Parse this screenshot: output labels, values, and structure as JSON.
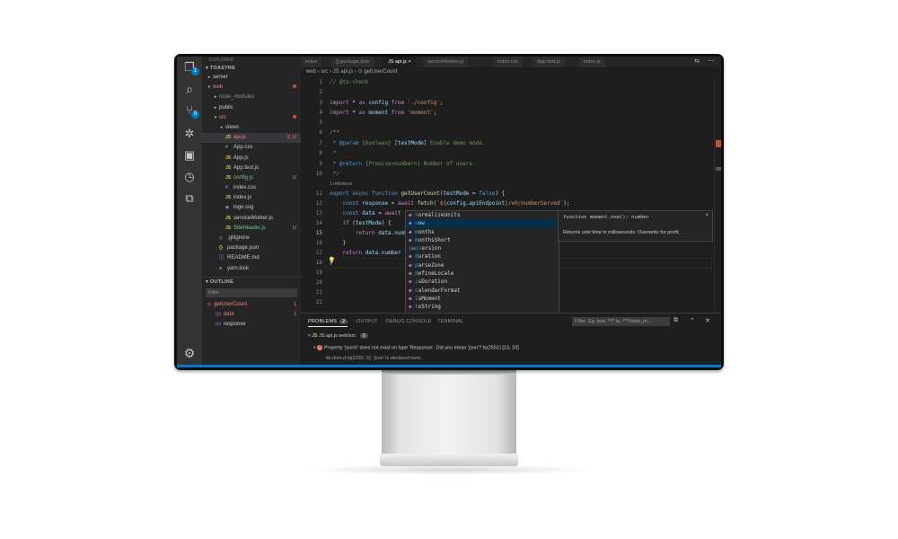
{
  "activity_bar": {
    "explorer_badge": "1",
    "scm_badge": "5"
  },
  "sidebar": {
    "header": "EXPLORER",
    "project": "TOASTRE",
    "tree": [
      {
        "label": "server",
        "twisty": "▸",
        "depth": 0,
        "color": "#cccccc",
        "icon": "",
        "status": ""
      },
      {
        "label": "web",
        "twisty": "▾",
        "depth": 0,
        "color": "#f48771",
        "icon": "",
        "status": "dot"
      },
      {
        "label": "node_modules",
        "twisty": "▸",
        "depth": 1,
        "color": "#8c8c8c",
        "icon": "",
        "status": ""
      },
      {
        "label": "public",
        "twisty": "▸",
        "depth": 1,
        "color": "#cccccc",
        "icon": "",
        "status": ""
      },
      {
        "label": "src",
        "twisty": "▾",
        "depth": 1,
        "color": "#f48771",
        "icon": "",
        "status": "dot"
      },
      {
        "label": "views",
        "twisty": "▸",
        "depth": 2,
        "color": "#cccccc",
        "icon": "",
        "status": ""
      },
      {
        "label": "api.js",
        "twisty": "",
        "depth": 2,
        "color": "#f48771",
        "icon": "JS",
        "status": "2, U"
      },
      {
        "label": "App.css",
        "twisty": "",
        "depth": 2,
        "color": "#cccccc",
        "icon": "#",
        "status": ""
      },
      {
        "label": "App.js",
        "twisty": "",
        "depth": 2,
        "color": "#cccccc",
        "icon": "JS",
        "status": ""
      },
      {
        "label": "App.test.js",
        "twisty": "",
        "depth": 2,
        "color": "#cccccc",
        "icon": "JS",
        "status": ""
      },
      {
        "label": "config.js",
        "twisty": "",
        "depth": 2,
        "color": "#73c991",
        "icon": "JS",
        "status": "U"
      },
      {
        "label": "index.css",
        "twisty": "",
        "depth": 2,
        "color": "#cccccc",
        "icon": "#",
        "status": ""
      },
      {
        "label": "index.js",
        "twisty": "",
        "depth": 2,
        "color": "#cccccc",
        "icon": "JS",
        "status": ""
      },
      {
        "label": "logo.svg",
        "twisty": "",
        "depth": 2,
        "color": "#cccccc",
        "icon": "◆",
        "status": ""
      },
      {
        "label": "serviceWorker.js",
        "twisty": "",
        "depth": 2,
        "color": "#cccccc",
        "icon": "JS",
        "status": ""
      },
      {
        "label": "SiteHeader.js",
        "twisty": "",
        "depth": 2,
        "color": "#73c991",
        "icon": "JS",
        "status": "U"
      },
      {
        "label": ".gitignore",
        "twisty": "",
        "depth": 1,
        "color": "#cccccc",
        "icon": "◇",
        "status": ""
      },
      {
        "label": "package.json",
        "twisty": "",
        "depth": 1,
        "color": "#cccccc",
        "icon": "{}",
        "status": ""
      },
      {
        "label": "README.md",
        "twisty": "",
        "depth": 1,
        "color": "#cccccc",
        "icon": "ⓘ",
        "status": ""
      },
      {
        "label": "yarn.lock",
        "twisty": "",
        "depth": 1,
        "color": "#cccccc",
        "icon": "♣",
        "status": ""
      }
    ],
    "outline_title": "OUTLINE",
    "outline_filter": "Filter",
    "outline": [
      {
        "label": "getUserCount",
        "icon": "⊙",
        "status": "1",
        "depth": 0,
        "color": "#f48771"
      },
      {
        "label": "data",
        "icon": "(x)",
        "status": "1",
        "depth": 1,
        "color": "#f48771"
      },
      {
        "label": "response",
        "icon": "(x)",
        "status": "",
        "depth": 1,
        "color": "#cccccc"
      }
    ]
  },
  "tabs": [
    {
      "label": "index",
      "active": false
    },
    {
      "label": "{} package.json",
      "active": false
    },
    {
      "label": "JS api.js ×",
      "active": true
    },
    {
      "label": "serviceWorker.js",
      "active": false
    },
    {
      "label": "index.css",
      "active": false
    },
    {
      "label": "App.test.js",
      "active": false
    },
    {
      "label": "index.js",
      "active": false
    }
  ],
  "breadcrumb": "web  ›  src  ›  JS api.js  ›  ⊙ getUserCount",
  "editor": {
    "line_numbers": [
      "1",
      "2",
      "3",
      "4",
      "5",
      "6",
      "7",
      "8",
      "9",
      "10",
      "",
      "11",
      "12",
      "13",
      "14",
      "15",
      "16",
      "17",
      "18",
      "19",
      "20",
      "21",
      "22"
    ],
    "references_lens": "1 reference"
  },
  "suggest": {
    "items": [
      {
        "label": "normalizeUnits",
        "match": "n",
        "icon": "◆"
      },
      {
        "label": "now",
        "match": "n",
        "icon": "◆"
      },
      {
        "label": "months",
        "match": "n",
        "icon": "◆"
      },
      {
        "label": "monthsShort",
        "match": "n",
        "icon": "◆"
      },
      {
        "label": "version",
        "match": "n",
        "icon": "[ab]"
      },
      {
        "label": "duration",
        "match": "n",
        "icon": "◆"
      },
      {
        "label": "parseZone",
        "match": "n",
        "icon": "◆"
      },
      {
        "label": "defineLocale",
        "match": "n",
        "icon": "◆"
      },
      {
        "label": "isDuration",
        "match": "n",
        "icon": "◆"
      },
      {
        "label": "calendarFormat",
        "match": "n",
        "icon": "◆"
      },
      {
        "label": "isMoment",
        "match": "n",
        "icon": "◆"
      },
      {
        "label": "toString",
        "match": "n",
        "icon": "◆"
      }
    ],
    "selected_index": 1,
    "detail_signature": "function moment.now(): number",
    "detail_description": "Returns unix time in milliseconds. Overwrite for profit.",
    "detail_close": "×"
  },
  "panel": {
    "tabs": [
      "PROBLEMS",
      "OUTPUT",
      "DEBUG CONSOLE",
      "TERMINAL"
    ],
    "problem_count": "2",
    "filter_placeholder": "Filter. Eg: text, **/*.ts, !**/node_m...",
    "file_row": "JS api.js  web/src",
    "file_count": "2",
    "error_message": "Property 'jsonX' does not exist on type 'Response'. Did you mean 'json'? ts(2551)  [13, 33]",
    "related_info": "lib.dom.d.ts[2230, 5]: 'json' is declared here."
  },
  "colors": {
    "accent": "#007acc",
    "error": "#f48771",
    "untracked": "#73c991"
  }
}
